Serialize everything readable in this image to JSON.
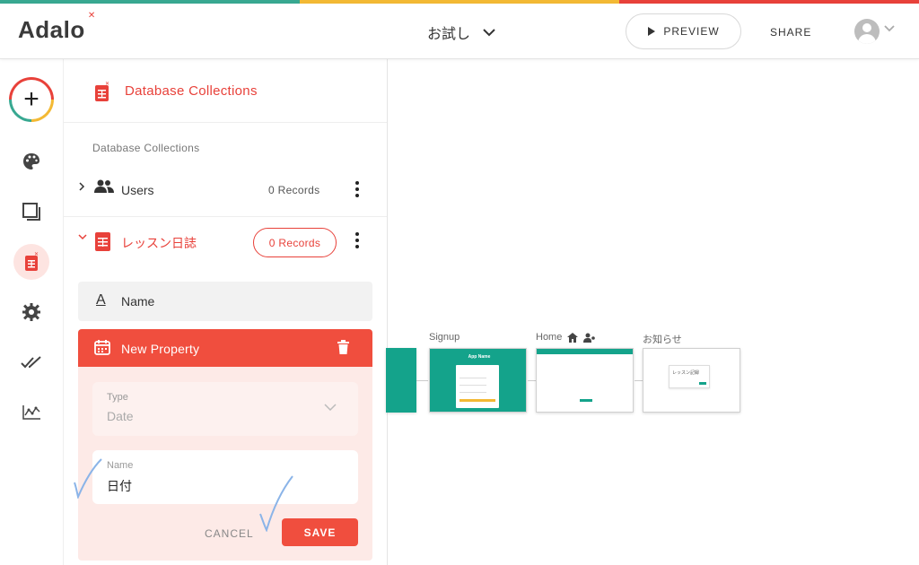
{
  "brand": {
    "logo_text": "Adalo",
    "colors": {
      "red": "#e8413a",
      "yellow": "#f3b934",
      "teal": "#38a891"
    }
  },
  "header": {
    "app_name": "お試し",
    "preview_label": "PREVIEW",
    "share_label": "SHARE"
  },
  "leftnav": {
    "items": [
      {
        "icon": "add-icon"
      },
      {
        "icon": "palette-icon"
      },
      {
        "icon": "screens-icon"
      },
      {
        "icon": "database-icon",
        "active": true
      },
      {
        "icon": "settings-icon"
      },
      {
        "icon": "double-check-icon"
      },
      {
        "icon": "analytics-icon"
      }
    ]
  },
  "panel": {
    "title": "Database Collections",
    "section_label": "Database Collections",
    "collections": [
      {
        "name": "Users",
        "records": "0 Records",
        "icon": "users-icon",
        "expanded": false
      },
      {
        "name": "レッスン日誌",
        "records": "0 Records",
        "icon": "table-icon",
        "expanded": true
      }
    ],
    "properties": [
      {
        "icon": "text-icon",
        "icon_glyph": "A",
        "name": "Name"
      }
    ],
    "new_property": {
      "title": "New Property",
      "type_label": "Type",
      "type_value": "Date",
      "name_label": "Name",
      "name_value": "日付",
      "cancel_label": "CANCEL",
      "save_label": "SAVE"
    }
  },
  "canvas": {
    "screens": [
      {
        "label": ""
      },
      {
        "label": "Signup",
        "inner_title": "App Name"
      },
      {
        "label": "Home",
        "home_icon": true,
        "user_icon": true
      },
      {
        "label": "お知らせ",
        "inner_text": "レッスン記録"
      }
    ]
  }
}
